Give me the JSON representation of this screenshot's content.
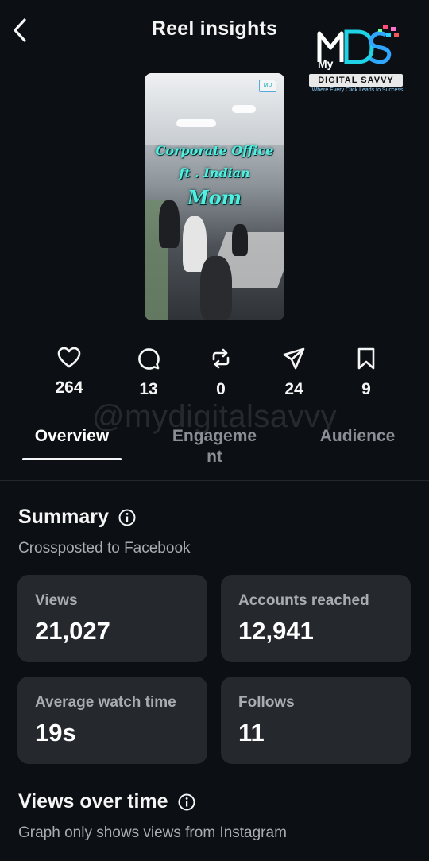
{
  "header": {
    "title": "Reel insights"
  },
  "logo": {
    "my": "My",
    "brand": "DIGITAL SAVVY",
    "tagline": "Where Every Click Leads to Success",
    "mini": "MD"
  },
  "reel": {
    "caption_line1": "Corporate Office",
    "caption_line2": "ft . Indian",
    "caption_line3": "Mom"
  },
  "stats": [
    {
      "icon": "heart-icon",
      "value": "264"
    },
    {
      "icon": "comment-icon",
      "value": "13"
    },
    {
      "icon": "repost-icon",
      "value": "0"
    },
    {
      "icon": "share-icon",
      "value": "24"
    },
    {
      "icon": "bookmark-icon",
      "value": "9"
    }
  ],
  "watermark": "@mydigitalsavvy",
  "tabs": [
    {
      "label": "Overview",
      "active": true
    },
    {
      "label": "Engageme nt",
      "active": false
    },
    {
      "label": "Audience",
      "active": false
    }
  ],
  "summary": {
    "title": "Summary",
    "subtitle": "Crossposted to Facebook",
    "cards": [
      {
        "label": "Views",
        "value": "21,027"
      },
      {
        "label": "Accounts reached",
        "value": "12,941"
      },
      {
        "label": "Average watch time",
        "value": "19s"
      },
      {
        "label": "Follows",
        "value": "11"
      }
    ]
  },
  "views_over_time": {
    "title": "Views over time",
    "subtitle": "Graph only shows views from Instagram"
  },
  "colors": {
    "background": "#0c1014",
    "card": "#25292e",
    "muted_text": "#a8adb2",
    "accent": "#4ff0e0"
  }
}
